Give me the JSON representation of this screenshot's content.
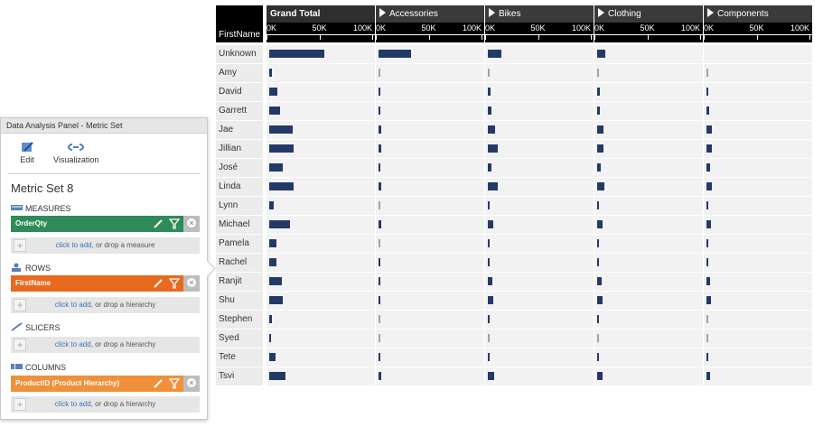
{
  "chart_data": {
    "type": "bar",
    "orientation": "horizontal",
    "row_header": "FirstName",
    "columns": [
      "Grand Total",
      "Accessories",
      "Bikes",
      "Clothing",
      "Components"
    ],
    "axis_ticks": [
      "0K",
      "50K",
      "100K"
    ],
    "xlim": [
      0,
      100000
    ],
    "categories": [
      "Unknown",
      "Amy",
      "David",
      "Garrett",
      "Jae",
      "Jillian",
      "José",
      "Linda",
      "Lynn",
      "Michael",
      "Pamela",
      "Rachel",
      "Ranjit",
      "Shu",
      "Stephen",
      "Syed",
      "Tete",
      "Tsvi"
    ],
    "series": [
      {
        "name": "Grand Total",
        "values": [
          52000,
          2500,
          8000,
          10000,
          22000,
          23000,
          13000,
          23000,
          4500,
          20000,
          7000,
          7000,
          12000,
          13000,
          2500,
          1000,
          6000,
          15000
        ]
      },
      {
        "name": "Accessories",
        "values": [
          31000,
          300,
          1500,
          1500,
          2500,
          2500,
          2000,
          2500,
          400,
          2500,
          700,
          1200,
          2000,
          2000,
          400,
          200,
          1000,
          2500
        ]
      },
      {
        "name": "Bikes",
        "values": [
          13000,
          200,
          2500,
          3000,
          7000,
          9000,
          3000,
          9000,
          1200,
          5000,
          2000,
          2000,
          4000,
          5000,
          1000,
          400,
          2000,
          6000
        ]
      },
      {
        "name": "Clothing",
        "values": [
          7500,
          300,
          2500,
          2500,
          6000,
          6000,
          3000,
          7000,
          1000,
          5000,
          2000,
          2000,
          4000,
          5000,
          1000,
          500,
          2000,
          5000
        ]
      },
      {
        "name": "Components",
        "values": [
          0,
          200,
          2000,
          2500,
          5500,
          5000,
          3000,
          5000,
          1000,
          4500,
          1000,
          1000,
          3500,
          4000,
          500,
          300,
          1500,
          3000
        ]
      }
    ],
    "bar_color": "#243a66"
  },
  "panel": {
    "title": "Data Analysis Panel - Metric Set",
    "edit_label": "Edit",
    "visualization_label": "Visualization",
    "metric_set_name": "Metric Set 8",
    "measures_label": "MEASURES",
    "measure_pill": "OrderQty",
    "measure_color": "#2e8b57",
    "rows_label": "ROWS",
    "row_pill": "FirstName",
    "row_color": "#e86a1f",
    "slicers_label": "SLICERS",
    "columns_label": "COLUMNS",
    "column_pill": "ProductID (Product Hierarchy)",
    "column_color": "#f0903a",
    "click_to_add": "click to add",
    "drop_measure": ", or drop a measure",
    "drop_hierarchy": ", or drop a hierarchy"
  }
}
